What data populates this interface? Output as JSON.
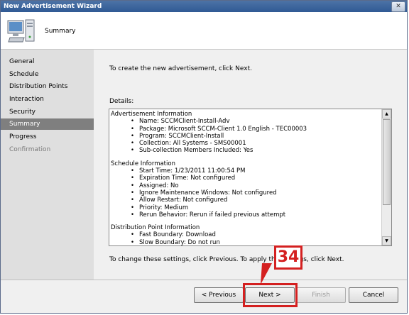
{
  "window": {
    "title": "New Advertisement Wizard",
    "close_glyph": "✕"
  },
  "header": {
    "title": "Summary",
    "icon": "computer-icon"
  },
  "sidebar": {
    "items": [
      {
        "label": "General",
        "state": "normal"
      },
      {
        "label": "Schedule",
        "state": "normal"
      },
      {
        "label": "Distribution Points",
        "state": "normal"
      },
      {
        "label": "Interaction",
        "state": "normal"
      },
      {
        "label": "Security",
        "state": "normal"
      },
      {
        "label": "Summary",
        "state": "active"
      },
      {
        "label": "Progress",
        "state": "normal"
      },
      {
        "label": "Confirmation",
        "state": "disabled"
      }
    ]
  },
  "main": {
    "intro": "To create the new advertisement, click Next.",
    "details_label": "Details:",
    "details_lines": [
      {
        "text": "Advertisement Information",
        "type": "heading"
      },
      {
        "text": "Name: SCCMClient-Install-Adv",
        "type": "bullet"
      },
      {
        "text": "Package: Microsoft SCCM-Client 1.0 English - TEC00003",
        "type": "bullet"
      },
      {
        "text": "Program: SCCMClient-Install",
        "type": "bullet"
      },
      {
        "text": "Collection: All Systems - SMS00001",
        "type": "bullet"
      },
      {
        "text": "Sub-collection Members Included: Yes",
        "type": "bullet"
      },
      {
        "text": "",
        "type": "gap"
      },
      {
        "text": "Schedule Information",
        "type": "heading"
      },
      {
        "text": "Start Time: 1/23/2011 11:00:54 PM",
        "type": "bullet"
      },
      {
        "text": "Expiration Time: Not configured",
        "type": "bullet"
      },
      {
        "text": "Assigned: No",
        "type": "bullet"
      },
      {
        "text": "Ignore Maintenance Windows: Not configured",
        "type": "bullet"
      },
      {
        "text": "Allow Restart: Not configured",
        "type": "bullet"
      },
      {
        "text": "Priority: Medium",
        "type": "bullet"
      },
      {
        "text": "Rerun Behavior: Rerun if failed previous attempt",
        "type": "bullet"
      },
      {
        "text": "",
        "type": "gap"
      },
      {
        "text": "Distribution Point Information",
        "type": "heading"
      },
      {
        "text": "Fast Boundary: Download",
        "type": "bullet"
      },
      {
        "text": "Slow Boundary: Do not run",
        "type": "bullet"
      }
    ],
    "footer_text": "To change these settings, click Previous. To apply the settings, click Next."
  },
  "buttons": {
    "previous": "< Previous",
    "next": "Next >",
    "finish": "Finish",
    "cancel": "Cancel"
  },
  "annotation": {
    "step_number": "34",
    "color": "#d42020"
  }
}
